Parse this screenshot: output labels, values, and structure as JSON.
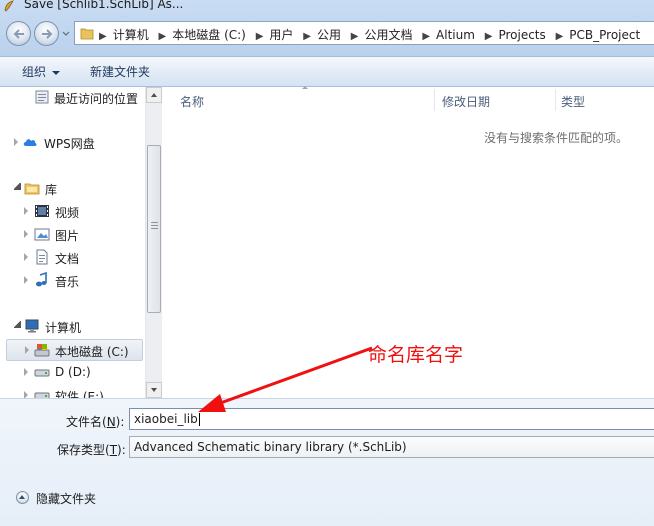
{
  "window": {
    "title": "Save [Schlib1.SchLib] As..."
  },
  "address_bar": {
    "breadcrumbs": [
      "计算机",
      "本地磁盘 (C:)",
      "用户",
      "公用",
      "公用文档",
      "Altium",
      "Projects",
      "PCB_Project"
    ]
  },
  "toolbar": {
    "organize": "组织",
    "new_folder": "新建文件夹"
  },
  "nav": {
    "recent": "最近访问的位置",
    "wps": "WPS网盘",
    "library": "库",
    "videos": "视频",
    "pictures": "图片",
    "documents": "文档",
    "music": "音乐",
    "computer": "计算机",
    "local_disk": "本地磁盘 (C:)",
    "d_drive": "D (D:)",
    "software_drive": "软件 (E:)"
  },
  "columns": {
    "name": "名称",
    "modified": "修改日期",
    "type": "类型"
  },
  "empty_message": "没有与搜索条件匹配的项。",
  "form": {
    "filename_label_pre": "文件名(",
    "filename_key": "N",
    "filename_label_post": "):",
    "filename_value": "xiaobei_lib",
    "filetype_label_pre": "保存类型(",
    "filetype_key": "T",
    "filetype_label_post": "):",
    "filetype_value": "Advanced Schematic binary library (*.SchLib)"
  },
  "hide_folders": "隐藏文件夹",
  "annotation": "命名库名字",
  "colors": {
    "annotation": "#f01010",
    "selection": "#dde4ec"
  }
}
